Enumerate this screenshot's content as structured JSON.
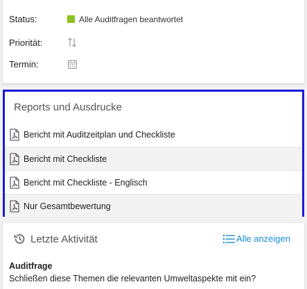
{
  "status_section": {
    "status_label": "Status:",
    "status_value": "Alle Auditfragen beantwortet",
    "status_color": "#8dc21f",
    "priority_label": "Priorität:",
    "priority_icon": "sort-arrows-icon",
    "deadline_label": "Termin:",
    "deadline_icon": "calendar-icon"
  },
  "reports": {
    "title": "Reports und Ausdrucke",
    "items": [
      {
        "label": "Bericht mit Auditzeitplan und Checkliste",
        "icon": "pdf-icon"
      },
      {
        "label": "Bericht mit Checkliste",
        "icon": "pdf-icon"
      },
      {
        "label": "Bericht mit Checkliste - Englisch",
        "icon": "pdf-icon"
      },
      {
        "label": "Nur Gesamtbewertung",
        "icon": "pdf-icon"
      }
    ],
    "highlight_color": "#1a1adc"
  },
  "activity": {
    "title": "Letzte Aktivität",
    "title_icon": "history-icon",
    "show_all_label": "Alle anzeigen",
    "show_all_icon": "list-icon",
    "show_all_color": "#1a8ccf",
    "entry_title": "Auditfrage",
    "entry_text": "Schließen diese Themen die relevanten Umweltaspekte mit ein?"
  }
}
